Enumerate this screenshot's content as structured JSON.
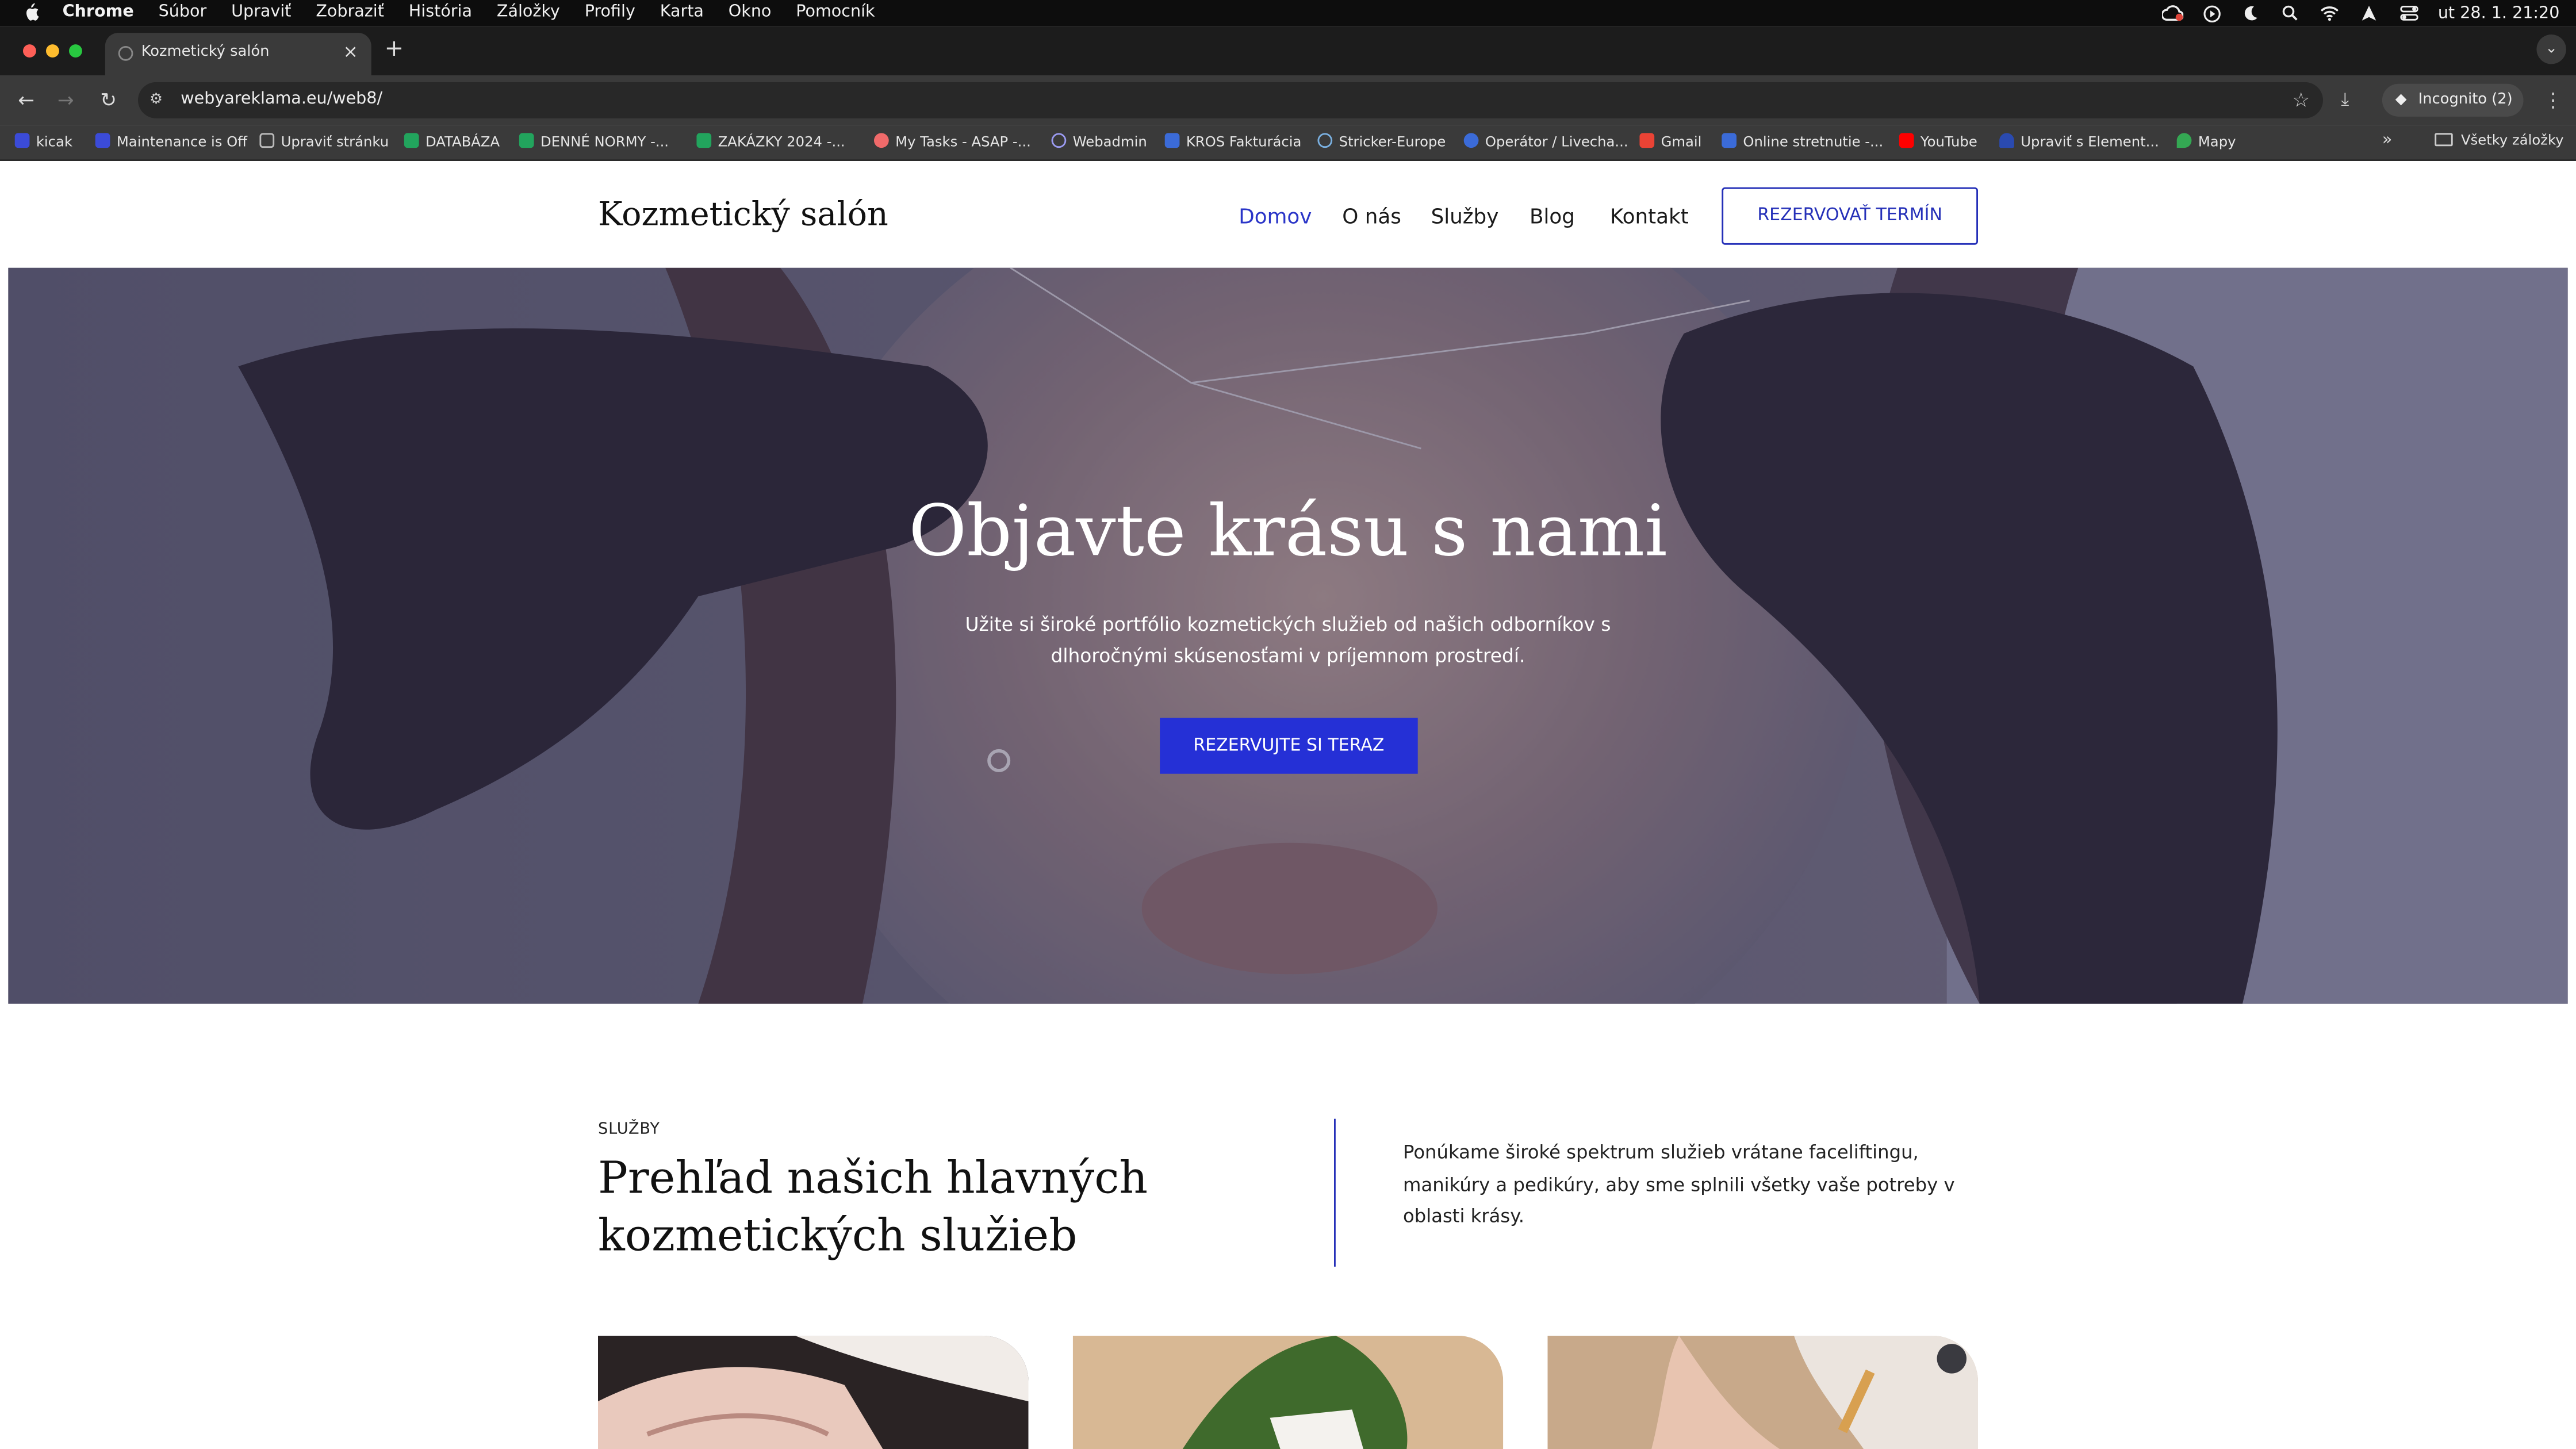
{
  "menubar": {
    "app": "Chrome",
    "items": [
      "Súbor",
      "Upraviť",
      "Zobraziť",
      "História",
      "Záložky",
      "Profily",
      "Karta",
      "Okno",
      "Pomocník"
    ],
    "clock": "ut 28. 1.  21:20"
  },
  "tab": {
    "title": "Kozmetický salón"
  },
  "omnibox": {
    "url": "webyareklama.eu/web8/"
  },
  "incognito": {
    "label": "Incognito (2)"
  },
  "bookmarks": {
    "items": [
      {
        "label": "kicak",
        "icon": "person-icon",
        "color": "#3b4bd8"
      },
      {
        "label": "Maintenance is Off",
        "icon": "person-icon",
        "color": "#3b4bd8"
      },
      {
        "label": "Upraviť stránku",
        "icon": "sparkle-icon",
        "color": "#bbbbbb"
      },
      {
        "label": "DATABÁZA",
        "icon": "sheets-icon",
        "color": "#22a45d"
      },
      {
        "label": "DENNÉ NORMY -...",
        "icon": "sheets-icon",
        "color": "#22a45d"
      },
      {
        "label": "ZAKÁZKY 2024 -...",
        "icon": "sheets-icon",
        "color": "#22a45d"
      },
      {
        "label": "My Tasks - ASAP -...",
        "icon": "asana-icon",
        "color": "#f06a6a"
      },
      {
        "label": "Webadmin",
        "icon": "globe-icon",
        "color": "#9a9af0"
      },
      {
        "label": "KROS Fakturácia",
        "icon": "doc-icon",
        "color": "#3b6bd8"
      },
      {
        "label": "Stricker-Europe",
        "icon": "globe-icon",
        "color": "#7ab0e0"
      },
      {
        "label": "Operátor / Livecha...",
        "icon": "chat-icon",
        "color": "#3b6bd8"
      },
      {
        "label": "Gmail",
        "icon": "gmail-icon",
        "color": "#ea4335"
      },
      {
        "label": "Online stretnutie -...",
        "icon": "calendar-icon",
        "color": "#3b6bd8"
      },
      {
        "label": "YouTube",
        "icon": "youtube-icon",
        "color": "#ff0000"
      },
      {
        "label": "Upraviť s Element...",
        "icon": "cloud-icon",
        "color": "#2a4ab0"
      },
      {
        "label": "Mapy",
        "icon": "map-pin-icon",
        "color": "#34a853"
      }
    ],
    "all_label": "Všetky záložky"
  },
  "site": {
    "logo": "Kozmetický salón",
    "nav": [
      "Domov",
      "O nás",
      "Služby",
      "Blog",
      "Kontakt"
    ],
    "cta": "REZERVOVAŤ TERMÍN",
    "accent": "#2530d6"
  },
  "hero": {
    "title": "Objavte krásu s nami",
    "subtitle": "Užite si široké portfólio kozmetických služieb od našich odborníkov s dlhoročnými skúsenosťami v príjemnom prostredí.",
    "button": "REZERVUJTE SI TERAZ"
  },
  "services": {
    "label": "SLUŽBY",
    "title": "Prehľad našich hlavných kozmetických služieb",
    "text": "Ponúkame široké spektrum služieb vrátane faceliftingu, manikúry a pedikúry, aby sme splnili všetky vaše potreby v oblasti krásy."
  }
}
